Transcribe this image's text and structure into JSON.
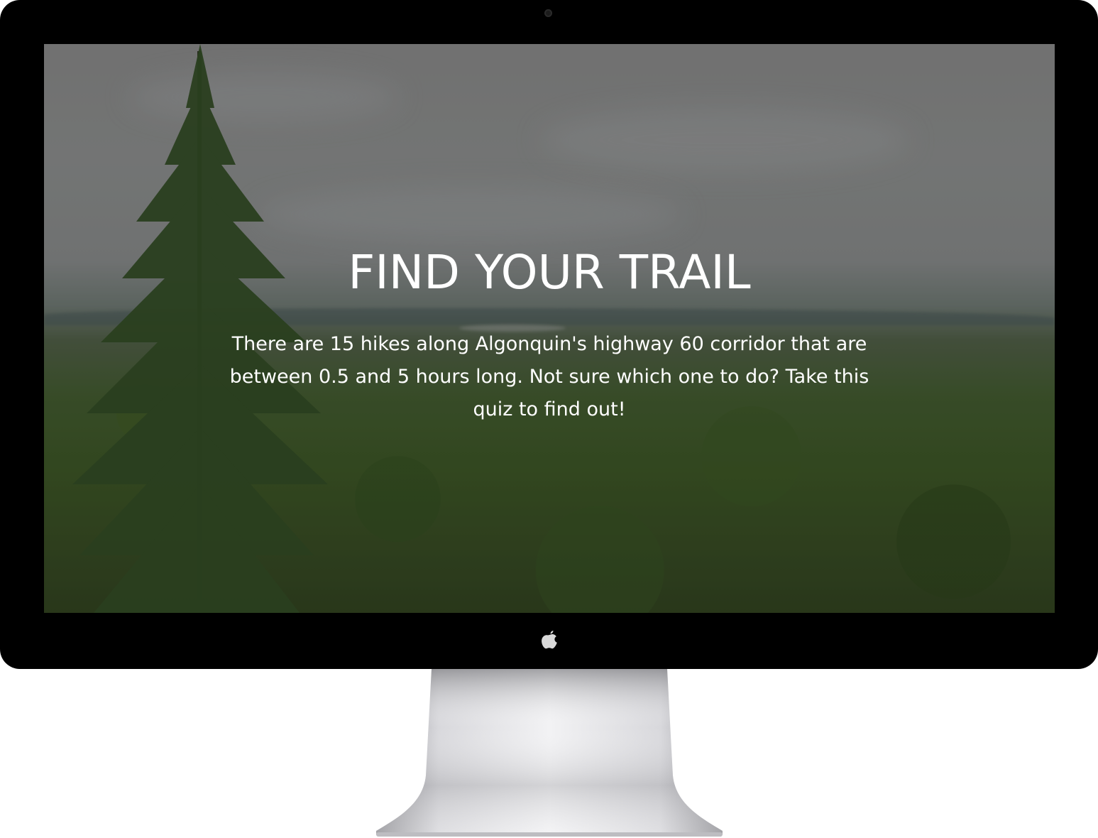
{
  "hero": {
    "title": "FIND YOUR TRAIL",
    "text": "There are 15 hikes along Algonquin's highway 60 corridor that are between 0.5 and 5 hours long. Not sure which one to do? Take this quiz to find out!"
  },
  "device": {
    "logo_icon": "apple-logo-icon",
    "bezel_color": "#000000"
  }
}
